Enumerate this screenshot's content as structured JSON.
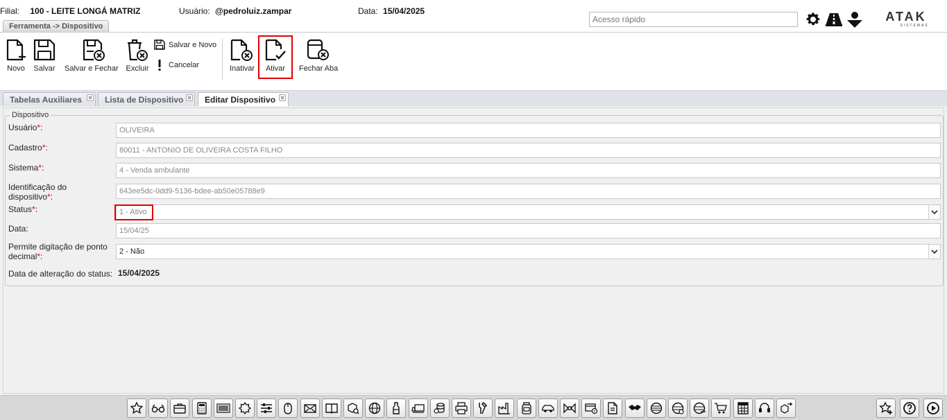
{
  "header": {
    "filial_label": "Filial:",
    "filial_value": "100 - LEITE LONGÁ MATRIZ",
    "usuario_label": "Usuário:",
    "usuario_value": "@pedroluiz.zampar",
    "data_label": "Data:",
    "data_value": "15/04/2025",
    "quick_access_placeholder": "Acesso rápido",
    "breadcrumb": "Ferramenta -> Dispositivo",
    "logo_text": "ATAK",
    "logo_subtext": "SISTEMAS"
  },
  "toolbar": {
    "novo": "Novo",
    "salvar": "Salvar",
    "salvar_fechar": "Salvar e Fechar",
    "excluir": "Excluir",
    "salvar_novo": "Salvar e Novo",
    "cancelar": "Cancelar",
    "inativar": "Inativar",
    "ativar": "Ativar",
    "fechar_aba": "Fechar Aba"
  },
  "tabs": [
    {
      "label": "Tabelas Auxiliares",
      "active": false
    },
    {
      "label": "Lista de Dispositivo",
      "active": false
    },
    {
      "label": "Editar Dispositivo",
      "active": true
    }
  ],
  "form": {
    "legend": "Dispositivo",
    "fields": {
      "usuario": {
        "label": "Usuário",
        "value": "OLIVEIRA"
      },
      "cadastro": {
        "label": "Cadastro",
        "value": "80011 - ANTONIO DE OLIVEIRA COSTA FILHO"
      },
      "sistema": {
        "label": "Sistema",
        "value": "4 - Venda ambulante"
      },
      "identificacao": {
        "label_line1": "Identificação do",
        "label_line2": "dispositivo",
        "value": "643ee5dc-0dd9-5136-bdee-ab50e05788e9"
      },
      "status": {
        "label": "Status",
        "value": "1 - Ativo"
      },
      "data": {
        "label": "Data:",
        "value": "15/04/25"
      },
      "permite": {
        "label_line1": "Permite digitação de ponto",
        "label_line2": "decimal",
        "value": "2 - Não"
      },
      "data_alteracao": {
        "label": "Data de alteração do status:",
        "value": "15/04/2025"
      }
    },
    "required_mark": "*",
    "colon": ":"
  },
  "dock_icons": [
    "star-icon",
    "glasses-icon",
    "briefcase-icon",
    "calculator-icon",
    "barcode-icon",
    "badge-icon",
    "sliders-icon",
    "mouse-icon",
    "mail-icon",
    "book-icon",
    "box-search-icon",
    "globe-icon",
    "bottle-icon",
    "truck-box-icon",
    "coins-icon",
    "printer-icon",
    "tools-icon",
    "factory-icon",
    "jar-icon",
    "car-icon",
    "bowtie-icon",
    "card-money-icon",
    "document-icon",
    "handshake-icon",
    "globe-lines-icon",
    "globe-settings-icon",
    "globe-arrows-icon",
    "cart-icon",
    "spreadsheet-icon",
    "headset-icon",
    "boxes-arrow-icon"
  ],
  "dock_right_icons": [
    "star-add-icon",
    "help-icon",
    "play-icon"
  ]
}
